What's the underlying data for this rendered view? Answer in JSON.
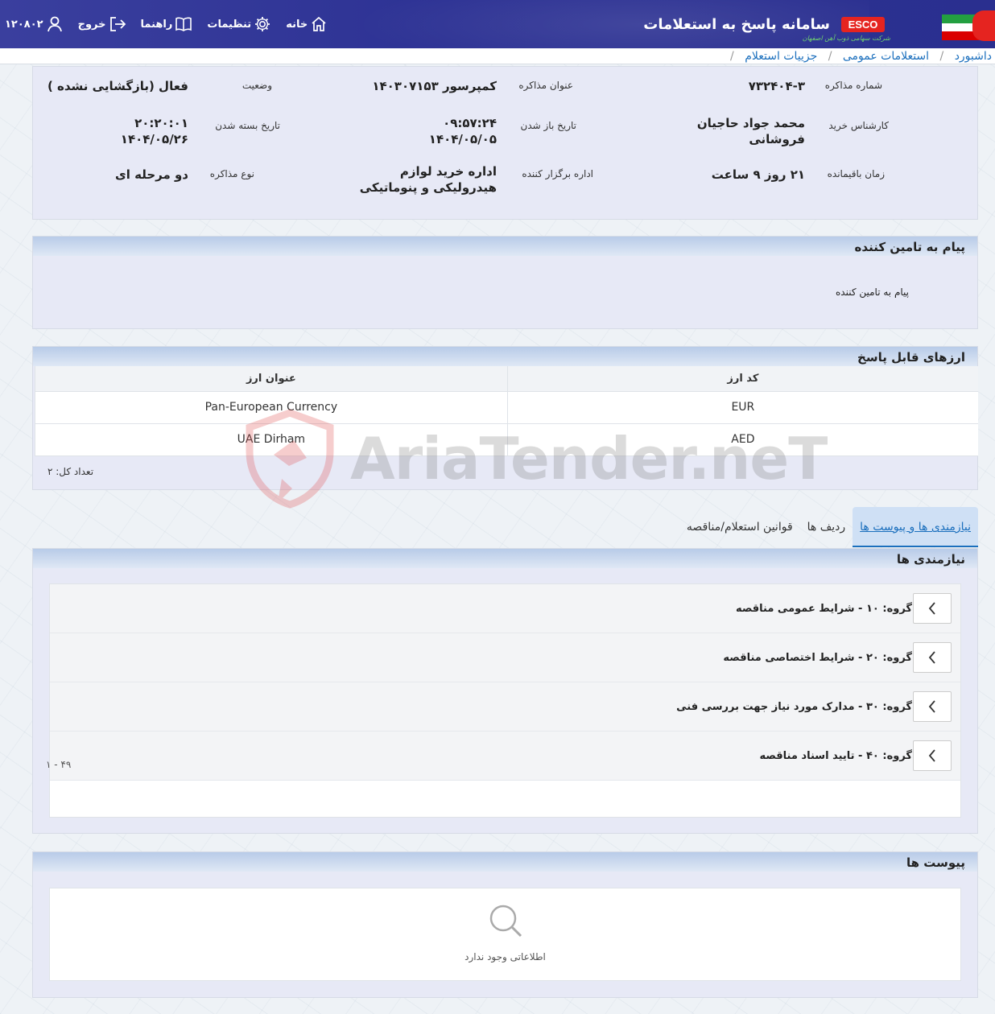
{
  "header": {
    "app_title": "سامانه پاسخ به استعلامات",
    "brand": "ESCO",
    "brand_sub": "شرکت سهامی ذوب آهن اصفهان",
    "nav": {
      "home": "خانه",
      "settings": "تنظیمات",
      "guide": "راهنما",
      "logout": "خروج",
      "user_id": "۱۲۰۸۰۲"
    }
  },
  "breadcrumb": {
    "items": [
      "داشبورد",
      "استعلامات عمومی",
      "جزییات استعلام"
    ],
    "separator": "/"
  },
  "details": {
    "negotiation_number": {
      "label": "شماره مذاکره",
      "value": "۷۳۲۴۰۴-۳"
    },
    "negotiation_title": {
      "label": "عنوان مذاکره",
      "value": "کمپرسور ۱۴۰۳۰۷۱۵۳"
    },
    "status": {
      "label": "وضعیت",
      "value": "فعال (بازگشایی نشده )"
    },
    "purchase_expert": {
      "label": "کارشناس خرید",
      "value_line1": "محمد جواد حاجیان",
      "value_line2": "فروشانی"
    },
    "open_date": {
      "label": "تاریخ باز شدن",
      "time": "۰۹:۵۷:۲۴",
      "date": "۱۴۰۴/۰۵/۰۵"
    },
    "close_date": {
      "label": "تاریخ بسته شدن",
      "time": "۲۰:۲۰:۰۱",
      "date": "۱۴۰۴/۰۵/۲۶"
    },
    "remaining_time": {
      "label": "زمان باقیمانده",
      "value": "۲۱ روز ۹ ساعت"
    },
    "organizer": {
      "label": "اداره برگزار کننده",
      "value_line1": "اداره خرید لوازم",
      "value_line2": "هیدرولیکی و پنوماتیکی"
    },
    "negotiation_type": {
      "label": "نوع مذاکره",
      "value": "دو مرحله ای"
    }
  },
  "message_panel": {
    "title": "پیام به تامین کننده",
    "label": "پیام به تامین کننده"
  },
  "currency_panel": {
    "title": "ارزهای قابل پاسخ",
    "columns": {
      "code": "کد ارز",
      "name": "عنوان ارز"
    },
    "rows": [
      {
        "code": "EUR",
        "name": "Pan-European Currency"
      },
      {
        "code": "AED",
        "name": "UAE Dirham"
      }
    ],
    "total": "تعداد کل: ۲"
  },
  "tabs": [
    {
      "label": "نیازمندی ها و پیوست ها",
      "active": true
    },
    {
      "label": "ردیف ها",
      "active": false
    },
    {
      "label": "قوانین استعلام/مناقصه",
      "active": false
    }
  ],
  "needs_panel": {
    "title": "نیازمندی ها",
    "groups": [
      "گروه: ۱۰ - شرایط عمومی مناقصه",
      "گروه: ۲۰ - شرایط اختصاصی مناقصه",
      "گروه: ۳۰ - مدارک مورد نیاز جهت بررسی فنی",
      "گروه: ۴۰ - تایید اسناد مناقصه"
    ],
    "paging": "۱ - ۴۹"
  },
  "attachments_panel": {
    "title": "پیوست ها",
    "empty_text": "اطلاعاتی وجود ندارد"
  },
  "watermark": {
    "text": "AriaTender.neT"
  },
  "colors": {
    "topbar": "#2d3294",
    "link": "#1b6fbd",
    "panel_bg": "#e7e9f6",
    "panel_head": "#b8cbe8",
    "esco_red": "#e52420"
  }
}
